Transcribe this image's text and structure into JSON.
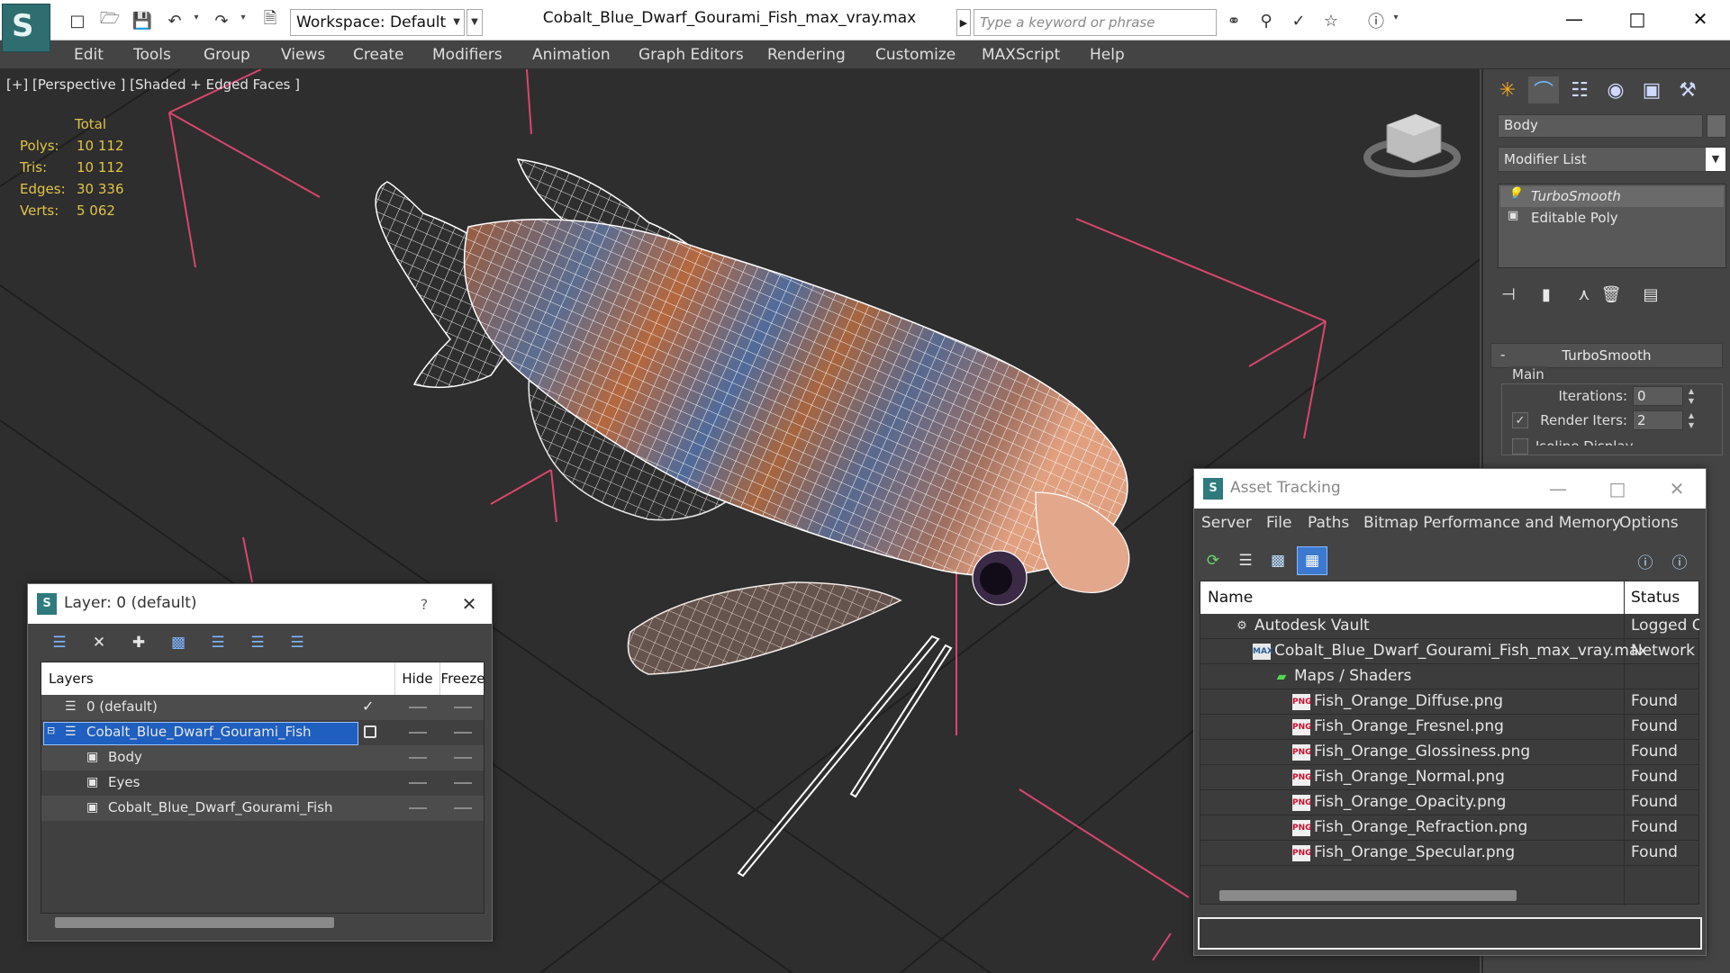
{
  "titlebar": {
    "workspace_label": "Workspace: Default",
    "file_title": "Cobalt_Blue_Dwarf_Gourami_Fish_max_vray.max",
    "search_placeholder": "Type a keyword or phrase"
  },
  "menu": [
    "Edit",
    "Tools",
    "Group",
    "Views",
    "Create",
    "Modifiers",
    "Animation",
    "Graph Editors",
    "Rendering",
    "Customize",
    "MAXScript",
    "Help"
  ],
  "viewport": {
    "label": "[+] [Perspective ] [Shaded + Edged Faces ]",
    "stats": {
      "header": "Total",
      "rows": [
        {
          "label": "Polys:",
          "value": "10 112"
        },
        {
          "label": "Tris:",
          "value": "10 112"
        },
        {
          "label": "Edges:",
          "value": "30 336"
        },
        {
          "label": "Verts:",
          "value": "5 062"
        }
      ]
    }
  },
  "command_panel": {
    "object_name": "Body",
    "modifier_list_label": "Modifier List",
    "stack": [
      "TurboSmooth",
      "Editable Poly"
    ],
    "rollout_title": "TurboSmooth",
    "main_group": "Main",
    "iterations_label": "Iterations:",
    "iterations_value": "0",
    "render_iters_label": "Render Iters:",
    "render_iters_value": "2",
    "isoline_label": "Isoline Display"
  },
  "layer_window": {
    "title": "Layer: 0 (default)",
    "help_glyph": "?",
    "columns": {
      "layers": "Layers",
      "hide": "Hide",
      "freeze": "Freeze"
    },
    "rows": [
      {
        "name": "0 (default)"
      },
      {
        "name": "Cobalt_Blue_Dwarf_Gourami_Fish"
      },
      {
        "name": "Body"
      },
      {
        "name": "Eyes"
      },
      {
        "name": "Cobalt_Blue_Dwarf_Gourami_Fish"
      }
    ]
  },
  "asset_window": {
    "title": "Asset Tracking",
    "menus": [
      "Server",
      "File",
      "Paths",
      "Bitmap Performance and Memory",
      "Options"
    ],
    "columns": {
      "name": "Name",
      "status": "Status"
    },
    "rows": [
      {
        "name": "Autodesk Vault",
        "status": "Logged O"
      },
      {
        "name": "Cobalt_Blue_Dwarf_Gourami_Fish_max_vray.max",
        "status": "Network P"
      },
      {
        "name": "Maps / Shaders",
        "status": ""
      },
      {
        "name": "Fish_Orange_Diffuse.png",
        "status": "Found"
      },
      {
        "name": "Fish_Orange_Fresnel.png",
        "status": "Found"
      },
      {
        "name": "Fish_Orange_Glossiness.png",
        "status": "Found"
      },
      {
        "name": "Fish_Orange_Normal.png",
        "status": "Found"
      },
      {
        "name": "Fish_Orange_Opacity.png",
        "status": "Found"
      },
      {
        "name": "Fish_Orange_Refraction.png",
        "status": "Found"
      },
      {
        "name": "Fish_Orange_Specular.png",
        "status": "Found"
      }
    ],
    "png_badge": "PNG",
    "max_badge": "MAX"
  },
  "colors": {
    "stats_yellow": "#e0c447",
    "selection_blue": "#1e5fbf",
    "grid_pink": "#d9466e",
    "app_teal": "#2f6e70"
  }
}
